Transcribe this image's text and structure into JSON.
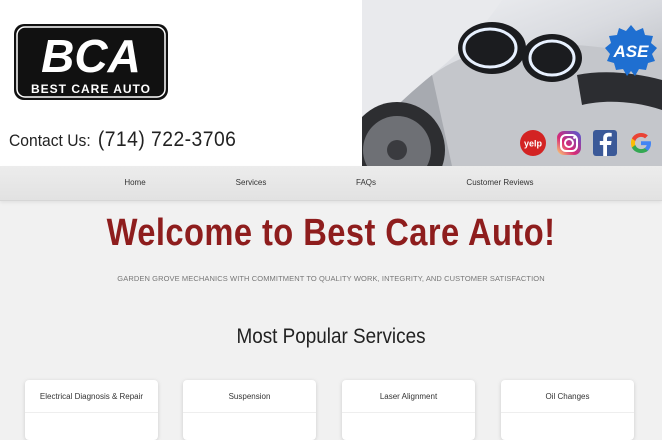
{
  "header": {
    "logo_text": "BCA",
    "logo_subtext": "BEST CARE AUTO",
    "contact_label": "Contact Us:",
    "phone": "(714) 722-3706",
    "badge_text": "ASE"
  },
  "social": {
    "yelp": "yelp-icon",
    "instagram": "instagram-icon",
    "facebook": "facebook-icon",
    "google": "google-icon"
  },
  "nav": {
    "items": [
      "Home",
      "Services",
      "FAQs",
      "Customer Reviews"
    ]
  },
  "main": {
    "welcome": "Welcome to Best Care Auto!",
    "subtitle": "GARDEN GROVE MECHANICS WITH COMMITMENT TO QUALITY WORK, INTEGRITY, AND CUSTOMER SATISFACTION",
    "popular_title": "Most Popular Services"
  },
  "services": [
    "Electrical Diagnosis & Repair",
    "Suspension",
    "Laser Alignment",
    "Oil Changes"
  ],
  "colors": {
    "brand_red": "#8e1d1d",
    "ase_blue": "#1f6fd1"
  }
}
